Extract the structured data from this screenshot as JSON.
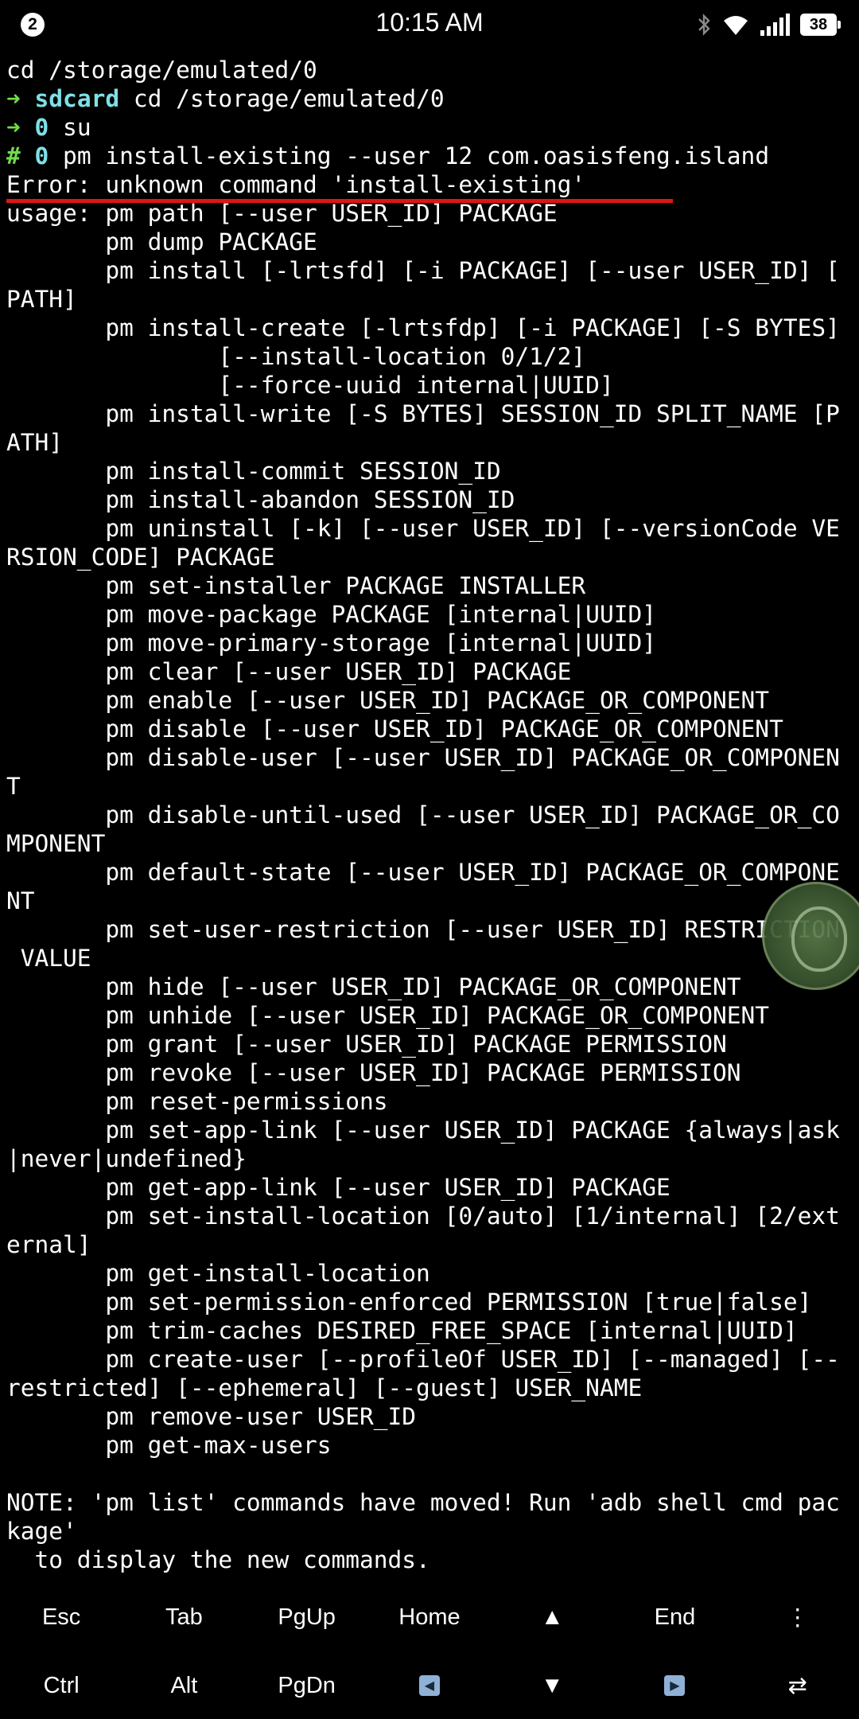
{
  "status_bar": {
    "notification_count": "2",
    "time": "10:15 AM",
    "battery": "38"
  },
  "terminal": {
    "lines": [
      "cd /storage/emulated/0",
      "usage: pm path [--user USER_ID] PACKAGE",
      "       pm dump PACKAGE",
      "       pm install [-lrtsfd] [-i PACKAGE] [--user USER_ID] [",
      "PATH]",
      "       pm install-create [-lrtsfdp] [-i PACKAGE] [-S BYTES]",
      "               [--install-location 0/1/2]",
      "               [--force-uuid internal|UUID]",
      "       pm install-write [-S BYTES] SESSION_ID SPLIT_NAME [P",
      "ATH]",
      "       pm install-commit SESSION_ID",
      "       pm install-abandon SESSION_ID",
      "       pm uninstall [-k] [--user USER_ID] [--versionCode VE",
      "RSION_CODE] PACKAGE",
      "       pm set-installer PACKAGE INSTALLER",
      "       pm move-package PACKAGE [internal|UUID]",
      "       pm move-primary-storage [internal|UUID]",
      "       pm clear [--user USER_ID] PACKAGE",
      "       pm enable [--user USER_ID] PACKAGE_OR_COMPONENT",
      "       pm disable [--user USER_ID] PACKAGE_OR_COMPONENT",
      "       pm disable-user [--user USER_ID] PACKAGE_OR_COMPONEN",
      "T",
      "       pm disable-until-used [--user USER_ID] PACKAGE_OR_CO",
      "MPONENT",
      "       pm default-state [--user USER_ID] PACKAGE_OR_COMPONE",
      "NT",
      "       pm set-user-restriction [--user USER_ID] RESTRICTION",
      " VALUE",
      "       pm hide [--user USER_ID] PACKAGE_OR_COMPONENT",
      "       pm unhide [--user USER_ID] PACKAGE_OR_COMPONENT",
      "       pm grant [--user USER_ID] PACKAGE PERMISSION",
      "       pm revoke [--user USER_ID] PACKAGE PERMISSION",
      "       pm reset-permissions",
      "       pm set-app-link [--user USER_ID] PACKAGE {always|ask",
      "|never|undefined}",
      "       pm get-app-link [--user USER_ID] PACKAGE",
      "       pm set-install-location [0/auto] [1/internal] [2/ext",
      "ernal]",
      "       pm get-install-location",
      "       pm set-permission-enforced PERMISSION [true|false]",
      "       pm trim-caches DESIRED_FREE_SPACE [internal|UUID]",
      "       pm create-user [--profileOf USER_ID] [--managed] [--",
      "restricted] [--ephemeral] [--guest] USER_NAME",
      "       pm remove-user USER_ID",
      "       pm get-max-users",
      "",
      "NOTE: 'pm list' commands have moved! Run 'adb shell cmd pac",
      "kage'",
      "  to display the new commands."
    ],
    "prompt_lines": [
      {
        "arrow": "➜",
        "dir": "sdcard",
        "cmd": " cd /storage/emulated/0"
      },
      {
        "arrow": "➜",
        "dir": "0",
        "cmd": " su"
      },
      {
        "arrow": "#",
        "dir": "0",
        "cmd": " pm install-existing --user 12 com.oasisfeng.island"
      }
    ],
    "error_line": "Error: unknown command 'install-existing'"
  },
  "extra_keys": {
    "row1": [
      "Esc",
      "Tab",
      "PgUp",
      "Home",
      "▲",
      "End",
      "⋮"
    ],
    "row2": [
      "Ctrl",
      "Alt",
      "PgDn",
      "◀",
      "▼",
      "▶",
      "⇄"
    ]
  },
  "colors": {
    "prompt_arrow": "#6fdc4a",
    "prompt_dir": "#7ee0e6",
    "highlight_underline": "#e11414"
  }
}
